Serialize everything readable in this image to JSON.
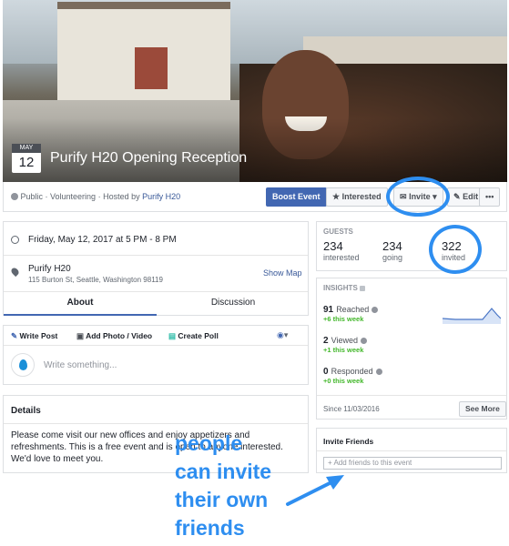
{
  "event": {
    "date_month": "MAY",
    "date_day": "12",
    "title": "Purify H20 Opening Reception",
    "meta_prefix": "Public · Volunteering · Hosted by",
    "host": "Purify H20"
  },
  "actions": {
    "boost": "Boost Event",
    "interested": "Interested",
    "invite": "Invite",
    "edit": "Edit",
    "more": "•••"
  },
  "details": {
    "datetime": "Friday, May 12, 2017 at 5 PM - 8 PM",
    "location_name": "Purify H20",
    "location_address": "115 Burton St, Seattle, Washington 98119",
    "show_map": "Show Map"
  },
  "tabs": [
    "About",
    "Discussion"
  ],
  "composer": {
    "write_post": "Write Post",
    "add_photo": "Add Photo / Video",
    "create_poll": "Create Poll",
    "placeholder": "Write something..."
  },
  "details_section": {
    "heading": "Details",
    "body": "Please come visit our new offices and enjoy appetizers and refreshments. This is a free event and is open to anyone interested. We'd love to meet you."
  },
  "guests": {
    "heading": "GUESTS",
    "interested_count": "234",
    "interested_label": "interested",
    "going_count": "234",
    "going_label": "going",
    "invited_count": "322",
    "invited_label": "invited"
  },
  "insights": {
    "heading": "INSIGHTS",
    "reached_count": "91",
    "reached_label": "Reached",
    "reached_delta": "+6 this week",
    "viewed_count": "2",
    "viewed_label": "Viewed",
    "viewed_delta": "+1 this week",
    "responded_count": "0",
    "responded_label": "Responded",
    "responded_delta": "+0 this week",
    "since": "Since 11/03/2016",
    "see_more": "See More"
  },
  "invite_friends": {
    "heading": "Invite Friends",
    "placeholder": "+ Add friends to this event"
  },
  "annotation": {
    "line1": "people",
    "line2": "can invite",
    "line3": "their own",
    "line4": "friends"
  },
  "colors": {
    "accent": "#4267b2",
    "link": "#385898",
    "annotation": "#2e8ef0",
    "positive": "#42b72a"
  }
}
